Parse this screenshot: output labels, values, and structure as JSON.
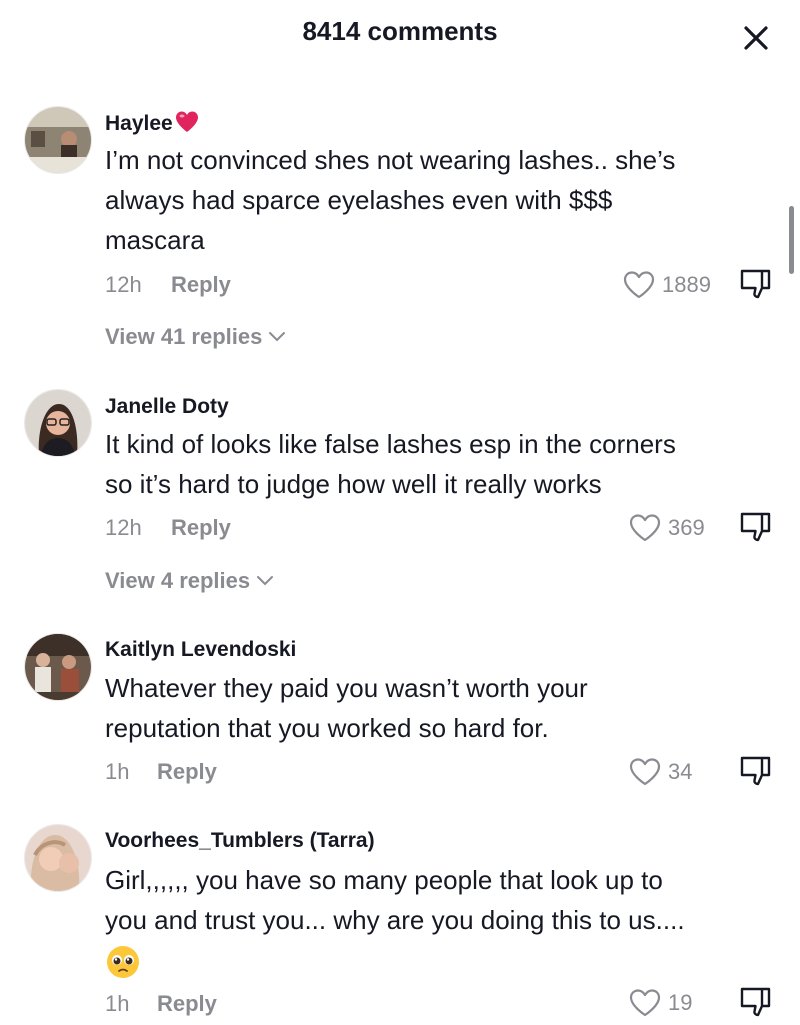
{
  "header": {
    "title": "8414 comments"
  },
  "comments": [
    {
      "name": "Haylee",
      "emoji": "heart",
      "text_lines": [
        "I’m not convinced shes not wearing lashes.. she’s",
        "always had sparce eyelashes even with $$$",
        "mascara"
      ],
      "time": "12h",
      "reply_label": "Reply",
      "likes": "1889",
      "view_replies": "View 41 replies"
    },
    {
      "name": "Janelle Doty",
      "text_lines": [
        "It kind of looks like false lashes esp in the corners",
        "so it’s hard to judge how well it really works"
      ],
      "time": "12h",
      "reply_label": "Reply",
      "likes": "369",
      "view_replies": "View 4 replies"
    },
    {
      "name": "Kaitlyn Levendoski",
      "text_lines": [
        "Whatever they paid you wasn’t worth your",
        "reputation that you worked so hard for."
      ],
      "time": "1h",
      "reply_label": "Reply",
      "likes": "34"
    },
    {
      "name": "Voorhees_Tumblers (Tarra)",
      "text_lines": [
        "Girl,,,,,, you have so many people that look up to",
        "you and trust you... why are you doing this to us...."
      ],
      "emoji": "pleading-face",
      "time": "1h",
      "reply_label": "Reply",
      "likes": "19"
    }
  ],
  "icons": {
    "close": "close-icon",
    "like": "heart-outline-icon",
    "dislike": "thumbs-down-icon",
    "chevron": "chevron-down-icon"
  },
  "colors": {
    "text": "#161823",
    "muted": "#8a8b91",
    "heart_emoji": "#e0245e"
  }
}
